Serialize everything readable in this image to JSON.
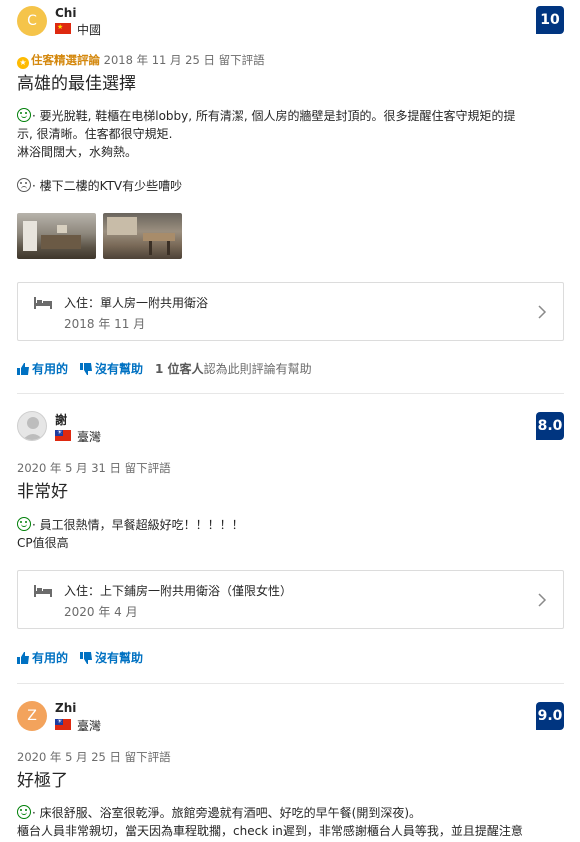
{
  "reviews": [
    {
      "initial": "C",
      "name": "Chi",
      "country": "中國",
      "score": "10",
      "badge": "住客精選評論",
      "date": "2018 年 11 月 25 日 留下評語",
      "title": "高雄的最佳選擇",
      "positive_line1": "· 要光脫鞋, 鞋櫃在电梯lobby, 所有清潔, 個人房的牆壁是封頂的。很多提醒住客守規矩的提",
      "positive_line2": "示, 很清晰。住客都很守規矩.",
      "positive_line3": "淋浴間闊大，水夠熱。",
      "negative": "· 樓下二樓的KTV有少些嘈吵",
      "stay_room": "入住：單人房一附共用衛浴",
      "stay_date": "2018 年 11 月",
      "helpful_label": "有用的",
      "unhelpful_label": "沒有幫助",
      "helpful_count": "1 位客人",
      "helpful_suffix": "認為此則評論有幫助"
    },
    {
      "initial": "",
      "name": "謝",
      "country": "臺灣",
      "score": "8.0",
      "date": "2020 年 5 月 31 日 留下評語",
      "title": "非常好",
      "positive_line1": "· 員工很熱情，早餐超級好吃！！！！！",
      "positive_line2": "CP值很高",
      "stay_room": "入住：上下鋪房一附共用衛浴（僅限女性）",
      "stay_date": "2020 年 4 月",
      "helpful_label": "有用的",
      "unhelpful_label": "沒有幫助"
    },
    {
      "initial": "Z",
      "name": "Zhi",
      "country": "臺灣",
      "score": "9.0",
      "date": "2020 年 5 月 25 日 留下評語",
      "title": "好極了",
      "positive_line1": "· 床很舒服、浴室很乾淨。旅館旁邊就有酒吧、好吃的早午餐(開到深夜)。",
      "positive_line2": "櫃台人員非常親切，當天因為車程耽擱，check in遲到，非常感謝櫃台人員等我，並且提醒注意"
    }
  ],
  "colors": {
    "score_bg": "#003580",
    "link": "#0071c2",
    "positive": "#008009",
    "badge": "#d4880e"
  }
}
